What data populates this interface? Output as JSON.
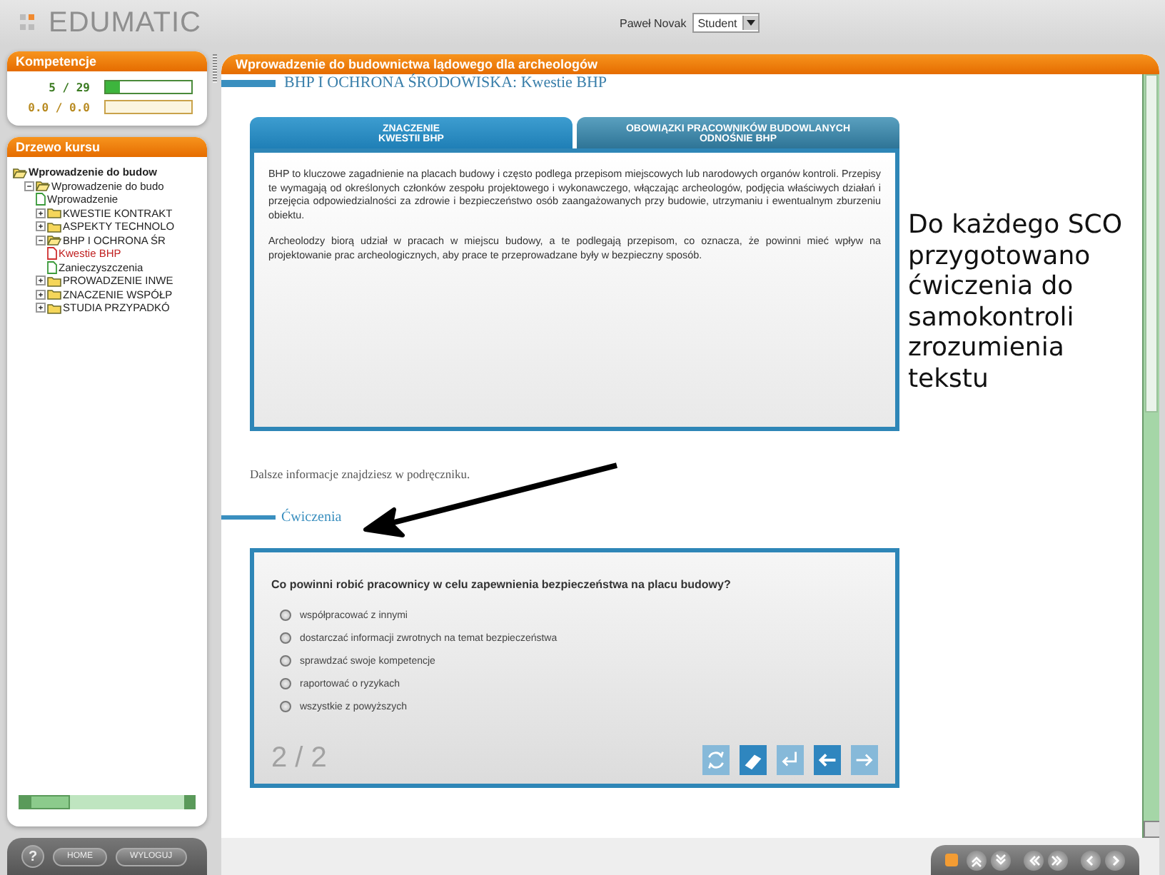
{
  "header": {
    "logo": "EDUMATIC",
    "user": "Paweł Novak",
    "role": "Student"
  },
  "competence": {
    "title": "Kompetencje",
    "rows": [
      {
        "reading": "5 / 29",
        "level": 0.17,
        "kind": "progress"
      },
      {
        "reading": "0.0 / 0.0",
        "level": 0,
        "kind": "score"
      }
    ]
  },
  "course_tree": {
    "title": "Drzewo kursu",
    "items": [
      {
        "label": "Wprowadzenie do budow",
        "kind": "root",
        "expanded": true,
        "children": [
          {
            "label": "Wprowadzenie do budo",
            "kind": "folder",
            "expanded": true,
            "children": [
              {
                "label": "Wprowadzenie",
                "kind": "page",
                "selected": false
              },
              {
                "label": "KWESTIE KONTRAKT",
                "kind": "folder",
                "expanded": false
              },
              {
                "label": "ASPEKTY TECHNOLO",
                "kind": "folder",
                "expanded": false
              },
              {
                "label": "BHP I OCHRONA ŚR",
                "kind": "folder",
                "expanded": true,
                "children": [
                  {
                    "label": "Kwestie BHP",
                    "kind": "page",
                    "selected": true
                  },
                  {
                    "label": "Zanieczyszczenia",
                    "kind": "page",
                    "selected": false
                  }
                ]
              },
              {
                "label": "PROWADZENIE INWE",
                "kind": "folder",
                "expanded": false
              },
              {
                "label": "ZNACZENIE WSPÓŁP",
                "kind": "folder",
                "expanded": false
              },
              {
                "label": "STUDIA PRZYPADKÓ",
                "kind": "folder",
                "expanded": false
              }
            ]
          }
        ]
      }
    ]
  },
  "footer_buttons": [
    {
      "kind": "help",
      "label": "?"
    },
    {
      "kind": "text",
      "label": "HOME"
    },
    {
      "kind": "text",
      "label": "WYLOGUJ"
    }
  ],
  "content": {
    "title": "Wprowadzenie do budownictwa lądowego dla archeologów",
    "section_heading": "BHP I OCHRONA ŚRODOWISKA: Kwestie BHP",
    "tabs": [
      {
        "label": "ZNACZENIE\nKWESTII BHP",
        "selected": true
      },
      {
        "label": "OBOWIĄZKI PRACOWNIKÓW BUDOWLANYCH\nODNOŚNIE BHP",
        "selected": false
      }
    ],
    "paragraphs": [
      "BHP to kluczowe zagadnienie na placach budowy i często podlega przepisom miejscowych lub narodowych organów kontroli. Przepisy te wymagają od określonych członków zespołu projektowego i wykonawczego, włączając archeologów, podjęcia właściwych działań i przejęcia odpowiedzialności za zdrowie i bezpieczeństwo osób zaangażowanych przy budowie, utrzymaniu i ewentualnym zburzeniu obiektu.",
      "Archeolodzy biorą udział w pracach w miejscu budowy, a te podlegają przepisom, co oznacza, że powinni mieć wpływ na projektowanie prac archeologicznych, aby prace te przeprowadzane były w bezpieczny sposób."
    ],
    "note": "Dalsze informacje znajdziesz w podręczniku.",
    "exercise_heading": "Ćwiczenia",
    "quiz": {
      "question": "Co powinni robić pracownicy w celu zapewnienia bezpieczeństwa na placu budowy?",
      "options": [
        {
          "label": "współpracować z innymi",
          "selected": false
        },
        {
          "label": "dostarczać informacji zwrotnych na temat bezpieczeństwa",
          "selected": false
        },
        {
          "label": "sprawdzać swoje kompetencje",
          "selected": false
        },
        {
          "label": "raportować o ryzykach",
          "selected": false
        },
        {
          "label": "wszystkie z powyższych",
          "selected": false
        }
      ],
      "counter": "2 / 2",
      "tools": [
        {
          "kind": "refresh",
          "disabled": true
        },
        {
          "kind": "eraser",
          "disabled": false
        },
        {
          "kind": "enter",
          "disabled": true
        },
        {
          "kind": "back",
          "disabled": false
        },
        {
          "kind": "forward",
          "disabled": true
        }
      ]
    }
  },
  "nav_buttons": [
    {
      "kind": "stop"
    },
    {
      "kind": "up"
    },
    {
      "kind": "down"
    },
    {
      "kind": "rewind"
    },
    {
      "kind": "fast-forward"
    },
    {
      "kind": "previous"
    },
    {
      "kind": "next"
    }
  ],
  "annotation": {
    "text": "Do każdego SCO przygotowano ćwiczenia do samokontroli zrozumienia tekstu"
  }
}
